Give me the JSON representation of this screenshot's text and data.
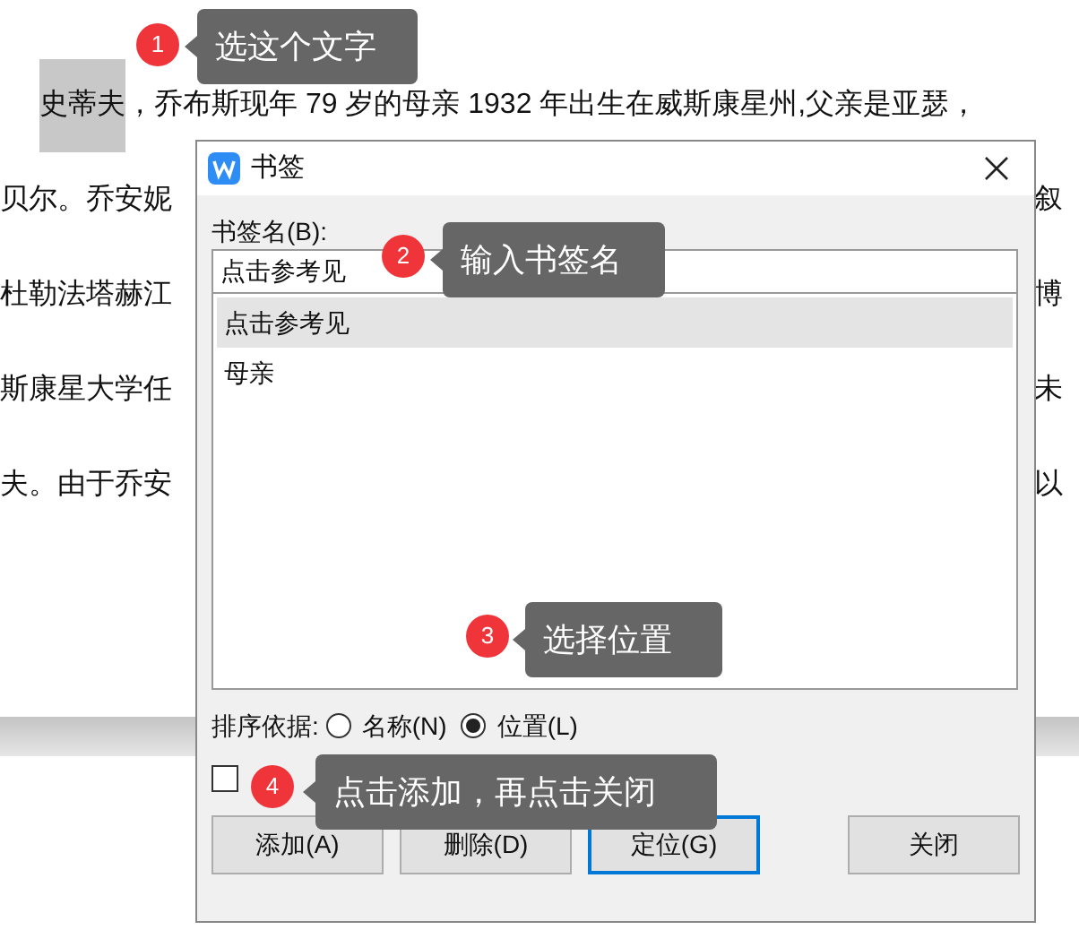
{
  "document": {
    "first_line": {
      "highlighted": "史蒂夫",
      "rest": "，乔布斯现年 79 岁的母亲 1932 年出生在威斯康星州,父亲是亚瑟，"
    },
    "lines": [
      {
        "left": "贝尔。乔安妮",
        "right": "叙"
      },
      {
        "left": "杜勒法塔赫江",
        "right": "博"
      },
      {
        "left": "斯康星大学任",
        "right": "未"
      },
      {
        "left": "夫。由于乔安",
        "right": "以"
      }
    ]
  },
  "dialog": {
    "title": "书签",
    "name_label": "书签名(B):",
    "name_value": "点击参考见",
    "bookmarks": [
      {
        "label": "点击参考见",
        "selected": true
      },
      {
        "label": "母亲",
        "selected": false
      }
    ],
    "sort_label": "排序依据:",
    "sort_options": [
      {
        "label": "名称(N)",
        "selected": false
      },
      {
        "label": "位置(L)",
        "selected": true
      }
    ],
    "hide_checkbox": {
      "checked": false
    },
    "buttons": [
      {
        "label": "添加(A)",
        "focused": false
      },
      {
        "label": "删除(D)",
        "focused": false
      },
      {
        "label": "定位(G)",
        "focused": true
      },
      {
        "label": "关闭",
        "focused": false
      }
    ]
  },
  "callouts": [
    {
      "number": "1",
      "text": "选这个文字"
    },
    {
      "number": "2",
      "text": "输入书签名"
    },
    {
      "number": "3",
      "text": "选择位置"
    },
    {
      "number": "4",
      "text": "点击添加，再点击关闭"
    }
  ]
}
